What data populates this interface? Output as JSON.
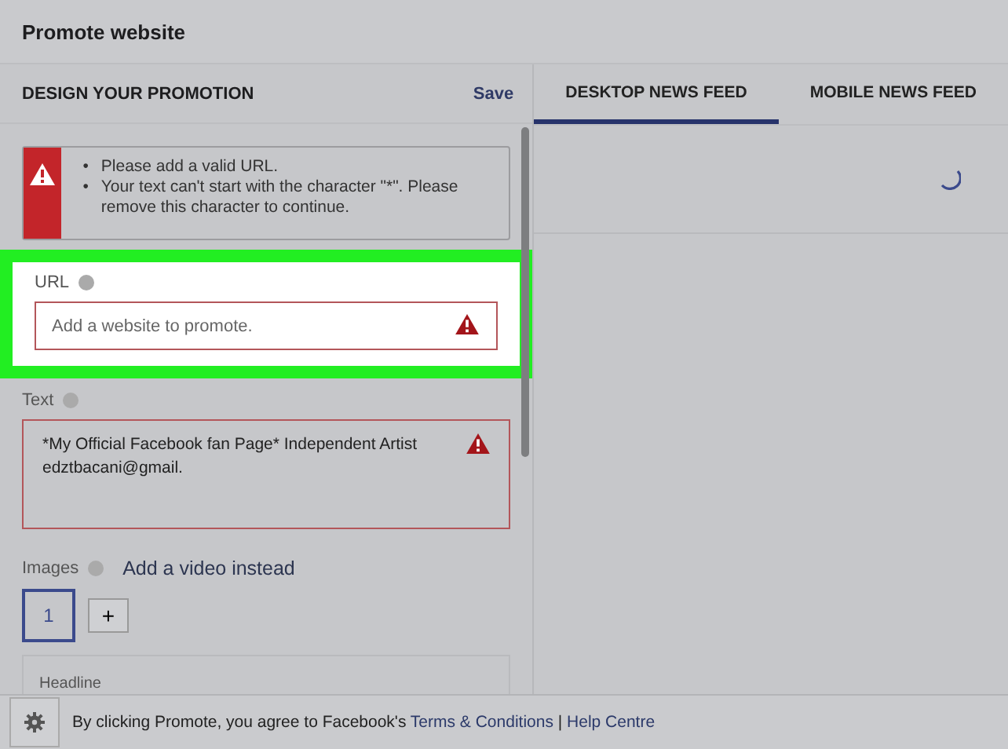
{
  "window": {
    "title": "Promote website"
  },
  "design": {
    "heading": "DESIGN YOUR PROMOTION",
    "save": "Save"
  },
  "errors": [
    {
      "bullet": "•",
      "text": "Please add a valid URL."
    },
    {
      "bullet": "•",
      "text": "Your text can't start with the character \"*\". Please remove this character to continue."
    }
  ],
  "url": {
    "label": "URL",
    "placeholder": "Add a website to promote.",
    "highlighted": true,
    "error": true
  },
  "text": {
    "label": "Text",
    "value": "*My Official Facebook fan Page* Independent Artist\nedztbacani@gmail.",
    "error": true
  },
  "images": {
    "label": "Images",
    "link": "Add a video instead",
    "slots": [
      {
        "label": "1",
        "selected": true
      }
    ],
    "add": "+"
  },
  "headline": {
    "label": "Headline"
  },
  "tabs": [
    {
      "label": "DESKTOP NEWS FEED",
      "selected": true
    },
    {
      "label": "MOBILE NEWS FEED",
      "selected": false
    }
  ],
  "preview": {
    "loading": true
  },
  "footer": {
    "text": "By clicking Promote, you agree to Facebook's",
    "terms": "Terms & Conditions",
    "separator": "|",
    "help": "Help Centre"
  }
}
